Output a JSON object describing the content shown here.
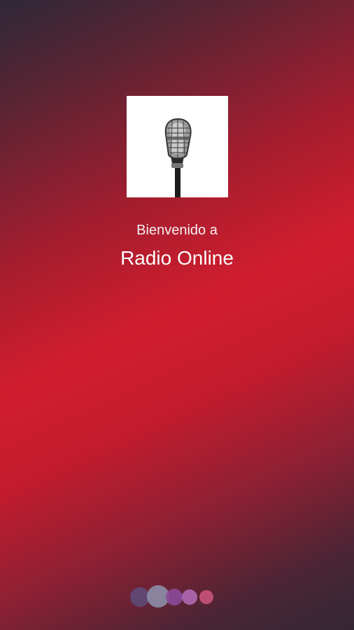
{
  "splash": {
    "welcome_text": "Bienvenido a",
    "app_name": "Radio Online",
    "logo_icon": "microphone-icon"
  },
  "loader": {
    "icon": "loading-dots-indicator",
    "dot_colors": [
      "#5e4a78",
      "#8e8ea8",
      "#8c4a9a",
      "#b06ab4",
      "#c8527a"
    ]
  },
  "colors": {
    "background_dark": "#342733",
    "background_accent": "#d21d2f",
    "text": "#ffffff"
  }
}
